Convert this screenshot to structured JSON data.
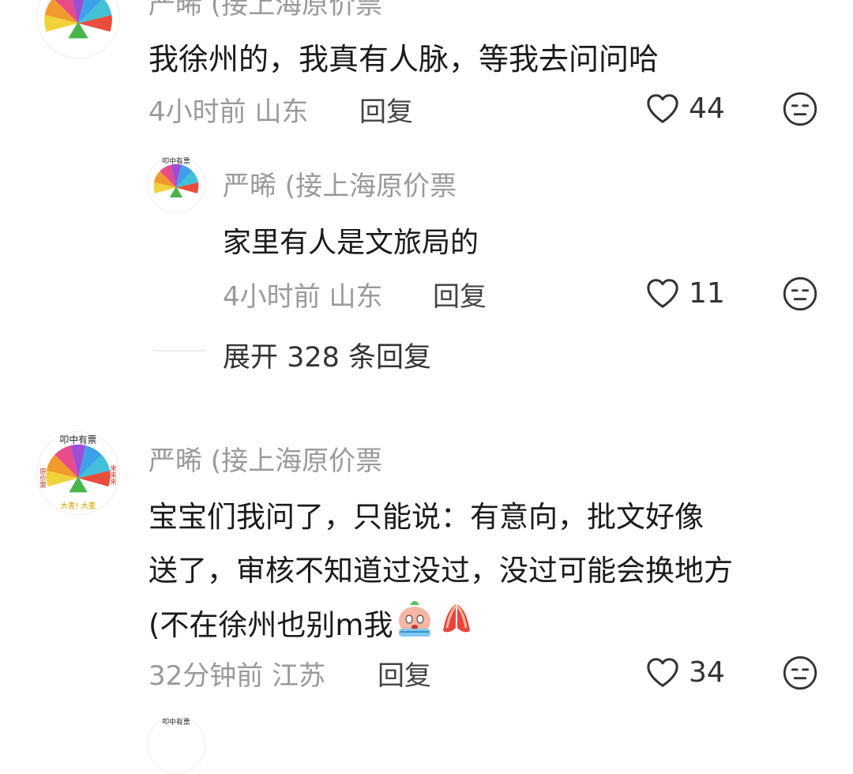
{
  "comments": [
    {
      "author": "严晞 (接上海原价票",
      "text_lines": [
        "我徐州的，我真有人脉，等我去问问哈"
      ],
      "time": "4小时前",
      "location": "山东",
      "reply_label": "回复",
      "likes": "44"
    },
    {
      "author": "严晞 (接上海原价票",
      "text_lines": [
        "家里有人是文旅局的"
      ],
      "time": "4小时前",
      "location": "山东",
      "reply_label": "回复",
      "likes": "11"
    },
    {
      "author": "严晞 (接上海原价票",
      "text_lines": [
        "宝宝们我问了，只能说：有意向，批文好像",
        "送了，审核不知道过没过，没过可能会换地方",
        "(不在徐州也别m我"
      ],
      "time": "32分钟前",
      "location": "江苏",
      "reply_label": "回复",
      "likes": "34"
    }
  ],
  "expand": {
    "label": "展开 328 条回复"
  },
  "avatar_text": {
    "top": "叩中有票",
    "left": "原价票",
    "right": "来来来",
    "bottom": "大麦! 大麦"
  },
  "colors": {
    "name": "#9a9a9a",
    "meta": "#9a9a9a",
    "text": "#1a1a1a",
    "icon": "#333333"
  },
  "icons": {
    "like": "heart-outline-icon",
    "dislike": "meh-face-icon",
    "emoji1": "crying-emoji",
    "emoji2": "praying-hands-emoji"
  }
}
